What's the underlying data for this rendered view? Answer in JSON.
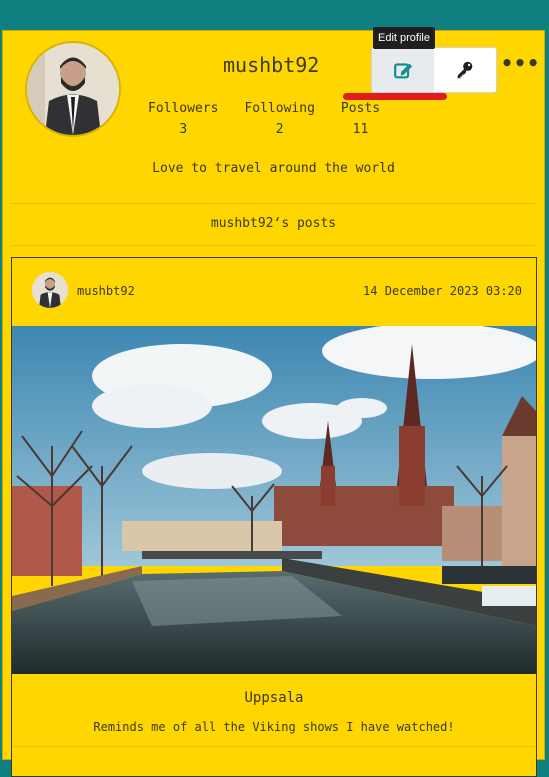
{
  "profile": {
    "username": "mushbt92",
    "bio": "Love to travel around the world",
    "stats": [
      {
        "label": "Followers",
        "value": "3"
      },
      {
        "label": "Following",
        "value": "2"
      },
      {
        "label": "Posts",
        "value": "11"
      }
    ],
    "posts_heading": "mushbt92‘s posts",
    "tooltip": "Edit profile",
    "more": "•••"
  },
  "post": {
    "username": "mushbt92",
    "date": "14 December 2023 03:20",
    "title": "Uppsala",
    "description": "Reminds me of all the Viking shows I have watched!"
  },
  "colors": {
    "background": "#0f7f7f",
    "card": "#ffd600",
    "accent": "#148f8f",
    "highlight": "#e21c1c"
  },
  "icons": {
    "edit": "edit-pencil-icon",
    "password": "key-icon",
    "menu": "more-dots-icon"
  }
}
